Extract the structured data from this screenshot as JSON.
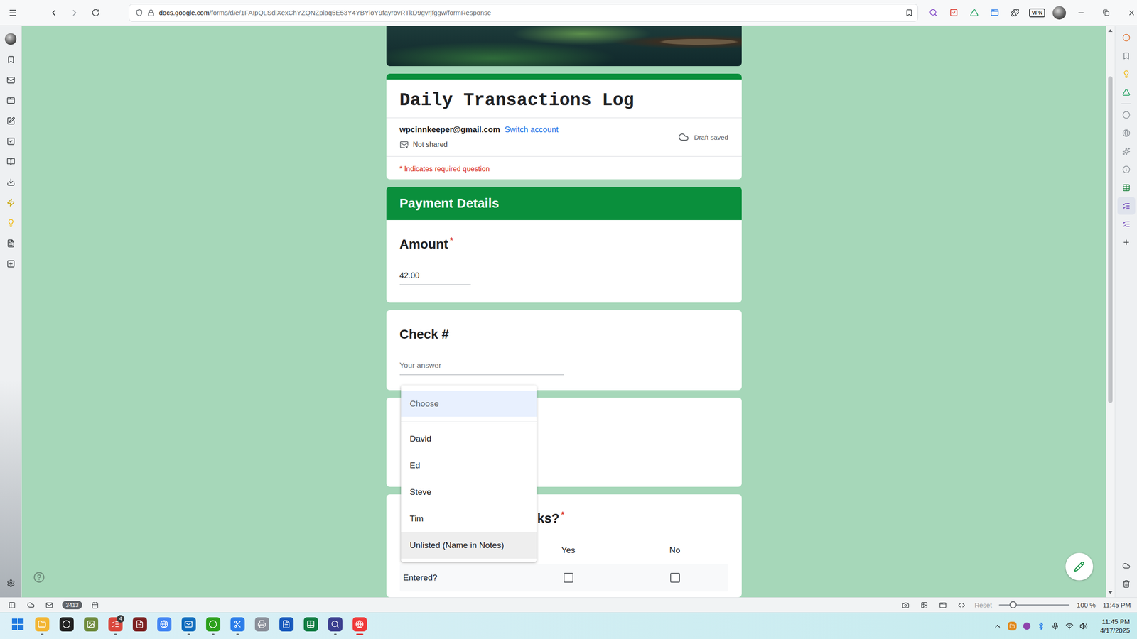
{
  "browser": {
    "url_host": "docs.google.com",
    "url_path": "/forms/d/e/1FAIpQLSdlXexChYZQNZpiaq5E53Y4YBYloY9fayrovRTkD9gvrjfggw/formResponse",
    "vpn": "VPN"
  },
  "form": {
    "title": "Daily Transactions Log",
    "account": "wpcinnkeeper@gmail.com",
    "switch_account": "Switch account",
    "sharing": "Not shared",
    "save_status": "Draft saved",
    "required_note": "* Indicates required question",
    "required_mark": "*",
    "section": "Payment Details",
    "questions": [
      {
        "kind": "number",
        "title": "Amount",
        "required": true,
        "value": "42.00",
        "placeholder": ""
      },
      {
        "kind": "text",
        "title": "Check #",
        "required": false,
        "value": "",
        "placeholder": "Your answer"
      },
      {
        "kind": "dropdown",
        "options": [
          {
            "label": "Choose",
            "kind": "placeholder",
            "selected": true,
            "hovered": false
          },
          {
            "label": "David",
            "kind": "option",
            "selected": false,
            "hovered": false
          },
          {
            "label": "Ed",
            "kind": "option",
            "selected": false,
            "hovered": false
          },
          {
            "label": "Steve",
            "kind": "option",
            "selected": false,
            "hovered": false
          },
          {
            "label": "Tim",
            "kind": "option",
            "selected": false,
            "hovered": false
          },
          {
            "label": "Unlisted (Name in Notes)",
            "kind": "option",
            "selected": false,
            "hovered": true
          }
        ]
      },
      {
        "kind": "grid",
        "title": "ks?",
        "required": true,
        "columns": [
          "Yes",
          "No"
        ],
        "rows": [
          {
            "label": "Entered?",
            "checked": [
              false,
              false
            ]
          }
        ]
      }
    ]
  },
  "scrollbar": {
    "offset": 0.075,
    "extent": 0.59
  },
  "status_bar": {
    "mail_count": "3413",
    "reset": "Reset",
    "zoom": "100 %",
    "zoom_level": 0.2,
    "time": "11:45 PM"
  },
  "taskbar": {
    "apps": [
      {
        "color": "#f2b531",
        "running": true,
        "active": false
      },
      {
        "color": "#222222",
        "running": false,
        "active": false
      },
      {
        "color": "#6d8a3b",
        "running": false,
        "active": false
      },
      {
        "color": "#d9463b",
        "running": true,
        "active": false,
        "badge": "4"
      },
      {
        "color": "#7a1f1f",
        "running": false,
        "active": false
      },
      {
        "color": "#4285f4",
        "running": false,
        "active": false
      },
      {
        "color": "#0f6cbd",
        "running": true,
        "active": false
      },
      {
        "color": "#2ca01c",
        "running": true,
        "active": false
      },
      {
        "color": "#2b7de9",
        "running": true,
        "active": false
      },
      {
        "color": "#8a8f99",
        "running": false,
        "active": false
      },
      {
        "color": "#185abd",
        "running": false,
        "active": false
      },
      {
        "color": "#107c41",
        "running": false,
        "active": false
      },
      {
        "color": "#3b3f8f",
        "running": true,
        "active": false
      },
      {
        "color": "#ef3939",
        "running": true,
        "active": true
      }
    ],
    "time": "11:45 PM",
    "date": "4/17/2025"
  }
}
